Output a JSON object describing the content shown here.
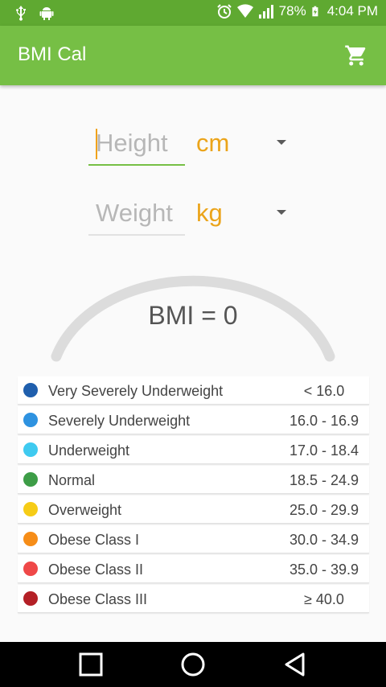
{
  "status_bar": {
    "battery": "78%",
    "time": "4:04 PM"
  },
  "app_bar": {
    "title": "BMI Cal"
  },
  "height_field": {
    "placeholder": "Height",
    "unit": "cm"
  },
  "weight_field": {
    "placeholder": "Weight",
    "unit": "kg"
  },
  "bmi_display": "BMI = 0",
  "colors": {
    "status_bar": "#5fa931",
    "app_bar": "#76bf45",
    "unit_text": "#eba41a",
    "gauge": "#dcdcdc"
  },
  "categories": [
    {
      "label": "Very Severely Underweight",
      "range": "< 16.0",
      "color": "#1f5fad"
    },
    {
      "label": "Severely Underweight",
      "range": "16.0 - 16.9",
      "color": "#2e92e0"
    },
    {
      "label": "Underweight",
      "range": "17.0 - 18.4",
      "color": "#3fcaf0"
    },
    {
      "label": "Normal",
      "range": "18.5 - 24.9",
      "color": "#3d9d47"
    },
    {
      "label": "Overweight",
      "range": "25.0 - 29.9",
      "color": "#f6cc17"
    },
    {
      "label": "Obese Class I",
      "range": "30.0 - 34.9",
      "color": "#f68d18"
    },
    {
      "label": "Obese Class II",
      "range": "35.0 - 39.9",
      "color": "#ef4848"
    },
    {
      "label": "Obese Class III",
      "range": "≥ 40.0",
      "color": "#b42026"
    }
  ],
  "icons": {
    "usb": "usb-icon",
    "android": "android-icon",
    "alarm": "alarm-icon",
    "wifi": "wifi-icon",
    "signal": "signal-icon",
    "battery": "battery-charging-icon",
    "cart": "shopping-cart-icon",
    "recents": "recents-square-icon",
    "home": "home-circle-icon",
    "back": "back-triangle-icon"
  }
}
